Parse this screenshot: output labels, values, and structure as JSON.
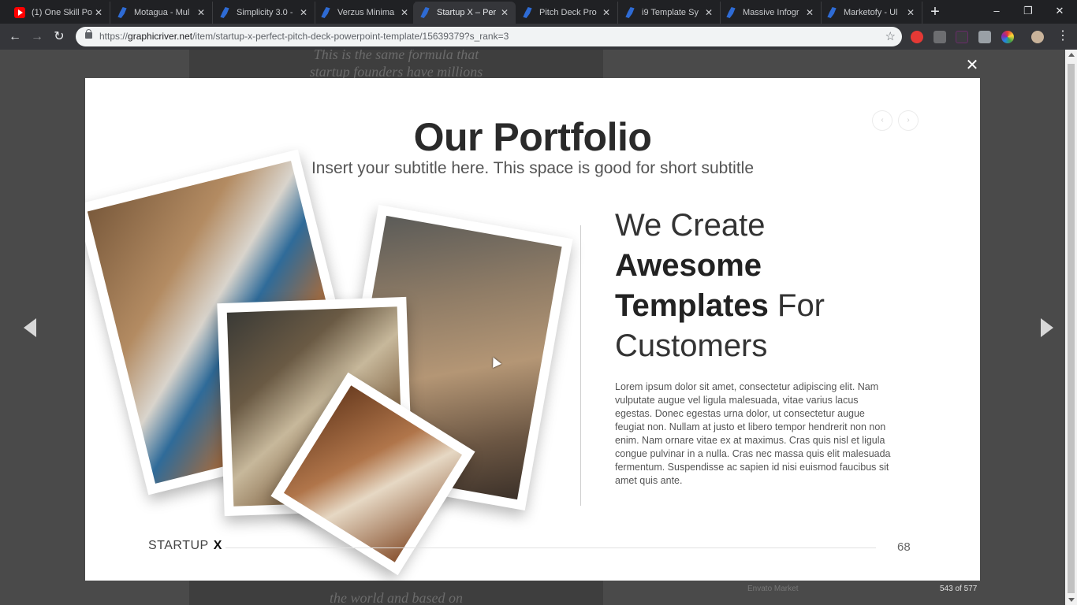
{
  "browser": {
    "tabs": [
      {
        "title": "(1) One Skill Po",
        "icon": "youtube-icon",
        "active": false
      },
      {
        "title": "Motagua - Mul",
        "icon": "envato-icon",
        "active": false
      },
      {
        "title": "Simplicity 3.0 -",
        "icon": "envato-icon",
        "active": false
      },
      {
        "title": "Verzus Minima",
        "icon": "envato-icon",
        "active": false
      },
      {
        "title": "Startup X – Per",
        "icon": "envato-icon",
        "active": true
      },
      {
        "title": "Pitch Deck Pro",
        "icon": "envato-icon",
        "active": false
      },
      {
        "title": "i9 Template Sy",
        "icon": "envato-icon",
        "active": false
      },
      {
        "title": "Massive Infogr",
        "icon": "envato-icon",
        "active": false
      },
      {
        "title": "Marketofy - Ul",
        "icon": "envato-icon",
        "active": false
      }
    ],
    "url_host": "graphicriver.net",
    "url_prefix": "https://",
    "url_path": "/item/startup-x-perfect-pitch-deck-powerpoint-template/15639379?s_rank=3",
    "window_controls": {
      "minimize": "–",
      "maximize": "❐",
      "close": "✕"
    },
    "newtab": "+"
  },
  "background": {
    "text_top_1": "This is the same formula that",
    "text_top_2": "startup founders have millions",
    "text_bottom_1": "the world and based on",
    "footer_link": "Envato Market"
  },
  "lightbox": {
    "close": "✕",
    "counter": "543 of 577"
  },
  "slide": {
    "title": "Our Portfolio",
    "subtitle": "Insert your subtitle here. This space is good for short subtitle",
    "headline": {
      "line1": "We Create",
      "line2_bold": "Awesome",
      "line3_bold": "Templates",
      "line3_light": " For",
      "line4": "Customers"
    },
    "body": "Lorem ipsum dolor sit amet, consectetur adipiscing elit. Nam vulputate augue vel ligula malesuada, vitae varius lacus egestas. Donec egestas urna dolor, ut consectetur augue feugiat non. Nullam at justo et libero tempor hendrerit non non enim. Nam ornare vitae ex at maximus. Cras quis nisl et ligula congue pulvinar in a nulla. Cras nec massa quis elit malesuada fermentum. Suspendisse ac sapien id nisi euismod faucibus sit amet quis ante.",
    "footer_brand": "STARTUP",
    "footer_brand_x": "X",
    "page_number": "68",
    "nav_prev": "‹",
    "nav_next": "›"
  }
}
